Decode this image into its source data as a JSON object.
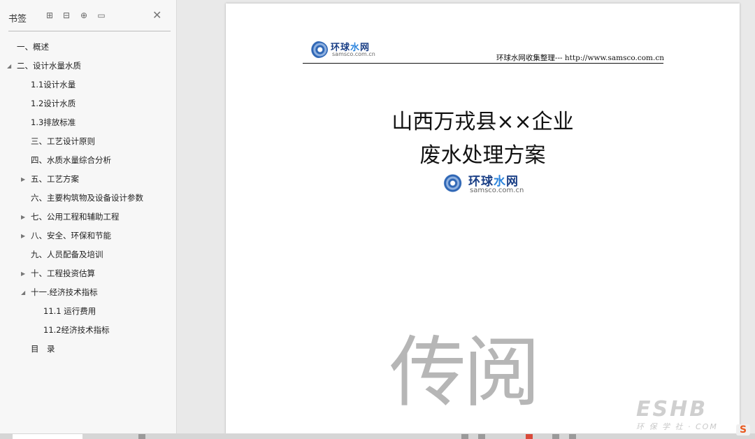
{
  "sidebar": {
    "title": "书签",
    "tools": [
      {
        "icon": "expand-all-icon",
        "glyph": "⊞"
      },
      {
        "icon": "collapse-all-icon",
        "glyph": "⊟"
      },
      {
        "icon": "add-bookmark-icon",
        "glyph": "⊕"
      },
      {
        "icon": "delete-bookmark-icon",
        "glyph": "▭"
      }
    ],
    "close_glyph": "✕",
    "items": [
      {
        "label": "一、概述",
        "level": 0,
        "arrow": ""
      },
      {
        "label": "二、设计水量水质",
        "level": 0,
        "arrow": "expanded"
      },
      {
        "label": "1.1设计水量",
        "level": 1,
        "arrow": ""
      },
      {
        "label": "1.2设计水质",
        "level": 1,
        "arrow": ""
      },
      {
        "label": "1.3排放标准",
        "level": 1,
        "arrow": ""
      },
      {
        "label": "三、工艺设计原则",
        "level": 1,
        "arrow": ""
      },
      {
        "label": "四、水质水量综合分析",
        "level": 1,
        "arrow": ""
      },
      {
        "label": "五、工艺方案",
        "level": 1,
        "arrow": "collapsed"
      },
      {
        "label": "六、主要构筑物及设备设计参数",
        "level": 1,
        "arrow": ""
      },
      {
        "label": "七、公用工程和辅助工程",
        "level": 1,
        "arrow": "collapsed"
      },
      {
        "label": "八、安全、环保和节能",
        "level": 1,
        "arrow": "collapsed"
      },
      {
        "label": "九、人员配备及培训",
        "level": 1,
        "arrow": ""
      },
      {
        "label": "十、工程投资估算",
        "level": 1,
        "arrow": "collapsed"
      },
      {
        "label": "十一.经济技术指标",
        "level": 1,
        "arrow": "expanded"
      },
      {
        "label": "11.1 运行费用",
        "level": 2,
        "arrow": ""
      },
      {
        "label": "11.2经济技术指标",
        "level": 2,
        "arrow": ""
      },
      {
        "label": "目　录",
        "level": 1,
        "arrow": ""
      }
    ]
  },
  "page": {
    "logo_name_a": "环球",
    "logo_name_b": "水",
    "logo_name_c": "网",
    "logo_url": "samsco.com.cn",
    "header_text": "环球水网收集整理--- http://www.samsco.com.cn",
    "title_line1": "山西万戎县××企业",
    "title_line2": "废水处理方案",
    "stamp": "传阅"
  },
  "watermark": {
    "big": "ESHB",
    "sub": "环 保 学 社 · COM",
    "s_glyph": "S"
  },
  "colors": {
    "logo_dark": "#1a3f86",
    "logo_blue": "#2e86de",
    "stamp_gray": "#b6b6b6"
  }
}
